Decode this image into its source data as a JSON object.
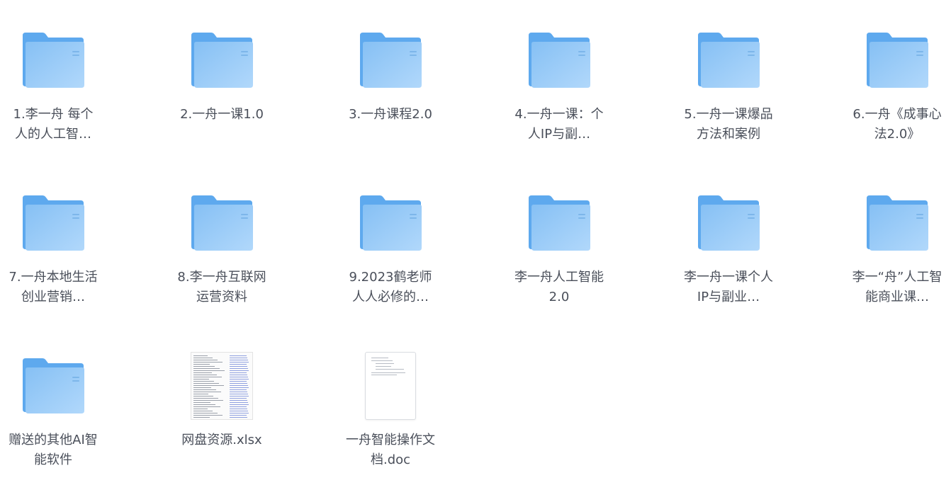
{
  "files": [
    {
      "name": "1.李一舟 每个人的人工智…",
      "type": "folder",
      "icon": "folder-icon"
    },
    {
      "name": "2.一舟一课1.0",
      "type": "folder",
      "icon": "folder-icon"
    },
    {
      "name": "3.一舟课程2.0",
      "type": "folder",
      "icon": "folder-icon"
    },
    {
      "name": "4.一舟一课：个人IP与副…",
      "type": "folder",
      "icon": "folder-icon"
    },
    {
      "name": "5.一舟一课爆品方法和案例",
      "type": "folder",
      "icon": "folder-icon"
    },
    {
      "name": "6.一舟《成事心法2.0》",
      "type": "folder",
      "icon": "folder-icon"
    },
    {
      "name": "7.一舟本地生活创业营销…",
      "type": "folder",
      "icon": "folder-icon"
    },
    {
      "name": "8.李一舟互联网运营资料",
      "type": "folder",
      "icon": "folder-icon"
    },
    {
      "name": "9.2023鹤老师人人必修的…",
      "type": "folder",
      "icon": "folder-icon"
    },
    {
      "name": "李一舟人工智能2.0",
      "type": "folder",
      "icon": "folder-icon"
    },
    {
      "name": "李一舟一课个人IP与副业…",
      "type": "folder",
      "icon": "folder-icon"
    },
    {
      "name": "李一“舟”人工智能商业课…",
      "type": "folder",
      "icon": "folder-icon"
    },
    {
      "name": "赠送的其他AI智能软件",
      "type": "folder",
      "icon": "folder-icon"
    },
    {
      "name": "网盘资源.xlsx",
      "type": "xlsx",
      "icon": "spreadsheet-thumbnail-icon"
    },
    {
      "name": "一舟智能操作文档.doc",
      "type": "doc",
      "icon": "document-thumbnail-icon"
    }
  ],
  "colors": {
    "folder_back": "#5ea9ee",
    "folder_front_top": "#8cc4f6",
    "folder_front_bottom": "#a9d4fa",
    "label_text": "#4a4f5a"
  }
}
